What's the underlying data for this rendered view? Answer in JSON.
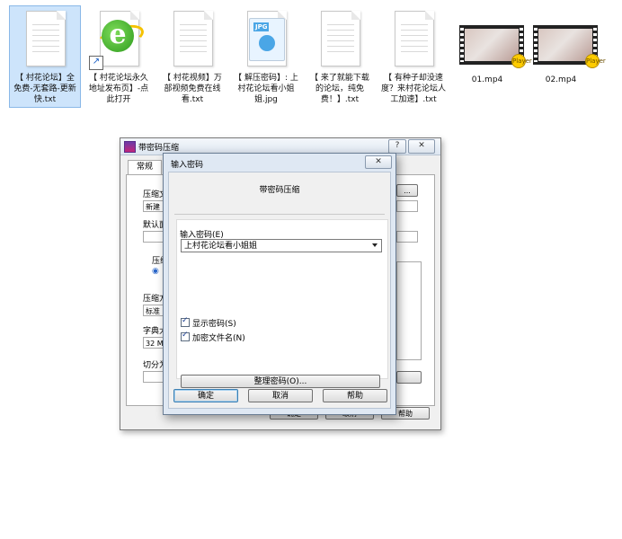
{
  "files": [
    {
      "label": "【 村花论坛】全免费-无套路-更新快.txt",
      "type": "txt",
      "selected": true
    },
    {
      "label": "【 村花论坛永久地址发布页】-点此打开",
      "type": "ie-shortcut",
      "selected": false
    },
    {
      "label": "【 村花视频】万部视频免费在线看.txt",
      "type": "txt",
      "selected": false
    },
    {
      "label": "【 解压密码】: 上村花论坛看小姐姐.jpg",
      "type": "jpg",
      "selected": false
    },
    {
      "label": "【 来了就能下载的论坛，纯免费！】.txt",
      "type": "txt",
      "selected": false
    },
    {
      "label": "【 有种子却没速度？来村花论坛人工加速】.txt",
      "type": "txt",
      "selected": false
    },
    {
      "label": "01.mp4",
      "type": "video",
      "selected": false
    },
    {
      "label": "02.mp4",
      "type": "video",
      "selected": false
    }
  ],
  "jpg_tag": "JPG",
  "video_badge": "Player",
  "back_dialog": {
    "title": "带密码压缩",
    "help_btn": "?",
    "close_btn": "✕",
    "tab": "常规",
    "labels": [
      "压缩文",
      "新建",
      "默认面",
      "压缩",
      "压缩方",
      "标准",
      "字典大",
      "32 MB",
      "切分为"
    ],
    "browse_btn": "...",
    "ok": "确定",
    "cancel": "取消",
    "help": "帮助"
  },
  "front_dialog": {
    "title": "输入密码",
    "close_btn": "✕",
    "heading": "带密码压缩",
    "password_label": "输入密码(E)",
    "password_value": "上村花论坛看小姐姐",
    "show_password": "显示密码(S)",
    "encrypt_names": "加密文件名(N)",
    "organize_btn": "整理密码(O)...",
    "ok": "确定",
    "cancel": "取消",
    "help": "帮助"
  }
}
